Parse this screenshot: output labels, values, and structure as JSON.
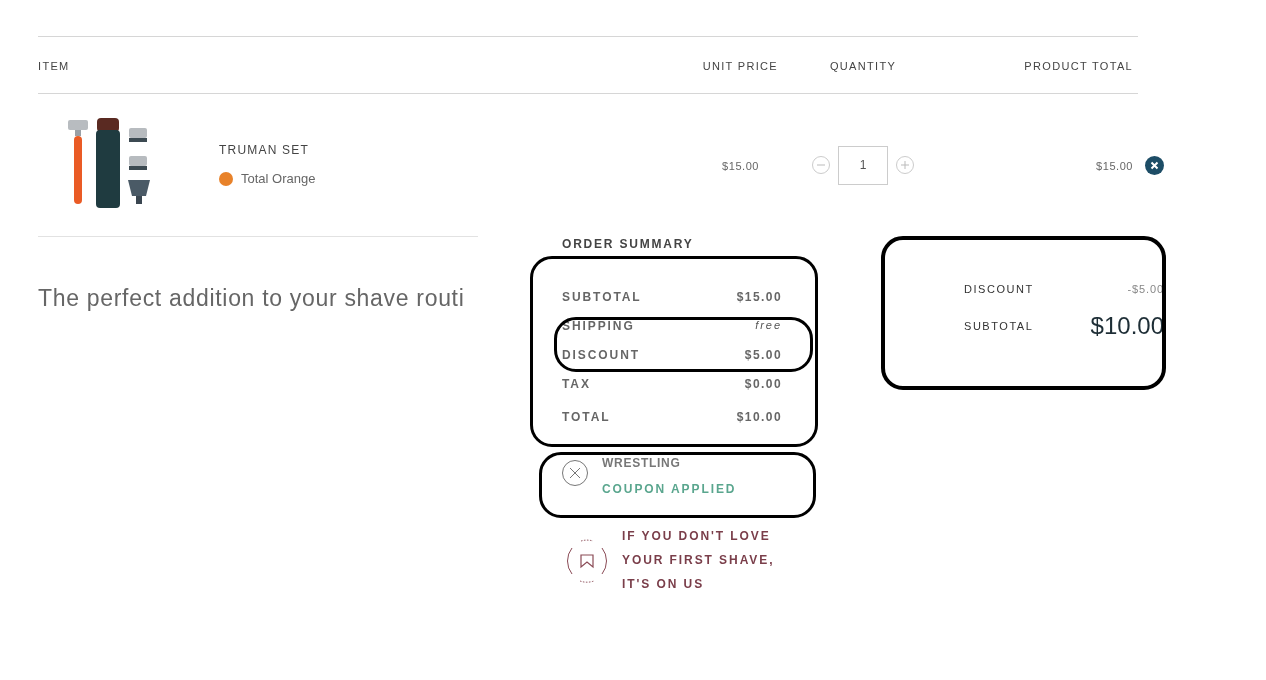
{
  "table": {
    "columns": [
      "ITEM",
      "UNIT PRICE",
      "QUANTITY",
      "PRODUCT TOTAL"
    ],
    "rows": [
      {
        "name": "TRUMAN SET",
        "variant": {
          "label": "Total Orange",
          "color": "#e8822a"
        },
        "unit_price": "$15.00",
        "quantity": "1",
        "total": "$15.00"
      }
    ]
  },
  "upsell": {
    "heading": "The perfect addition to your shave routi"
  },
  "order_summary": {
    "title": "ORDER SUMMARY",
    "lines": [
      {
        "label": "SUBTOTAL",
        "value": "$15.00",
        "kind": "money"
      },
      {
        "label": "SHIPPING",
        "value": "free",
        "kind": "note"
      },
      {
        "label": "DISCOUNT",
        "value": "$5.00",
        "kind": "money"
      },
      {
        "label": "TAX",
        "value": "$0.00",
        "kind": "money"
      },
      {
        "label": "TOTAL",
        "value": "$10.00",
        "kind": "money"
      }
    ],
    "coupon": {
      "code": "WRESTLING",
      "status": "COUPON APPLIED"
    },
    "guarantee": [
      "IF YOU DON'T LOVE",
      "YOUR FIRST SHAVE,",
      "IT'S ON US"
    ]
  },
  "cart_totals": {
    "discount_label": "DISCOUNT",
    "discount": "-$5.00",
    "subtotal_label": "SUBTOTAL",
    "subtotal": "$10.00"
  }
}
